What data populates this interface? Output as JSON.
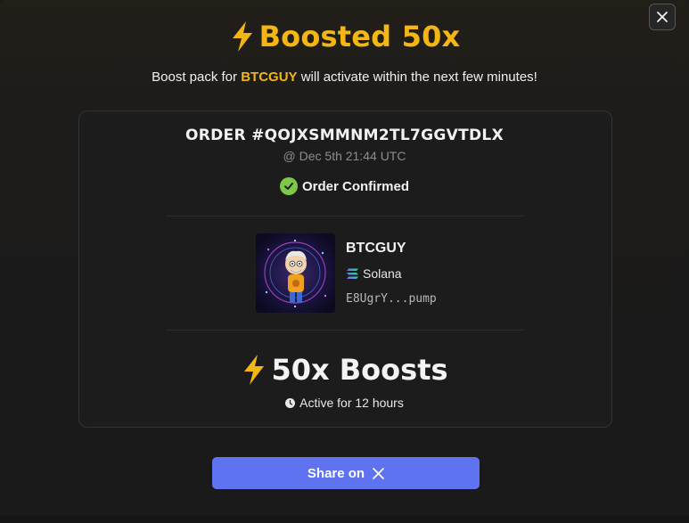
{
  "header": {
    "title": "Boosted 50x",
    "subtitle_prefix": "Boost pack for ",
    "subtitle_token": "BTCGUY",
    "subtitle_suffix": " will activate within the next few minutes!",
    "close_icon": "close-icon"
  },
  "order": {
    "id": "ORDER #QOJXSMMNM2TL7GGVTDLX",
    "timestamp": "@ Dec 5th 21:44 UTC",
    "status": "Order Confirmed",
    "status_icon": "check-circle-icon"
  },
  "token": {
    "name": "BTCGUY",
    "chain": "Solana",
    "chain_icon": "solana-icon",
    "address": "E8UgrY...pump",
    "image": "token-avatar"
  },
  "boost": {
    "label": "50x Boosts",
    "duration": "Active for 12 hours",
    "duration_icon": "clock-icon"
  },
  "share": {
    "label": "Share on",
    "icon": "x-logo-icon"
  },
  "colors": {
    "accent": "#f4b614",
    "button": "#5f73f0",
    "success": "#7ec846",
    "background": "#1c1b1a"
  }
}
